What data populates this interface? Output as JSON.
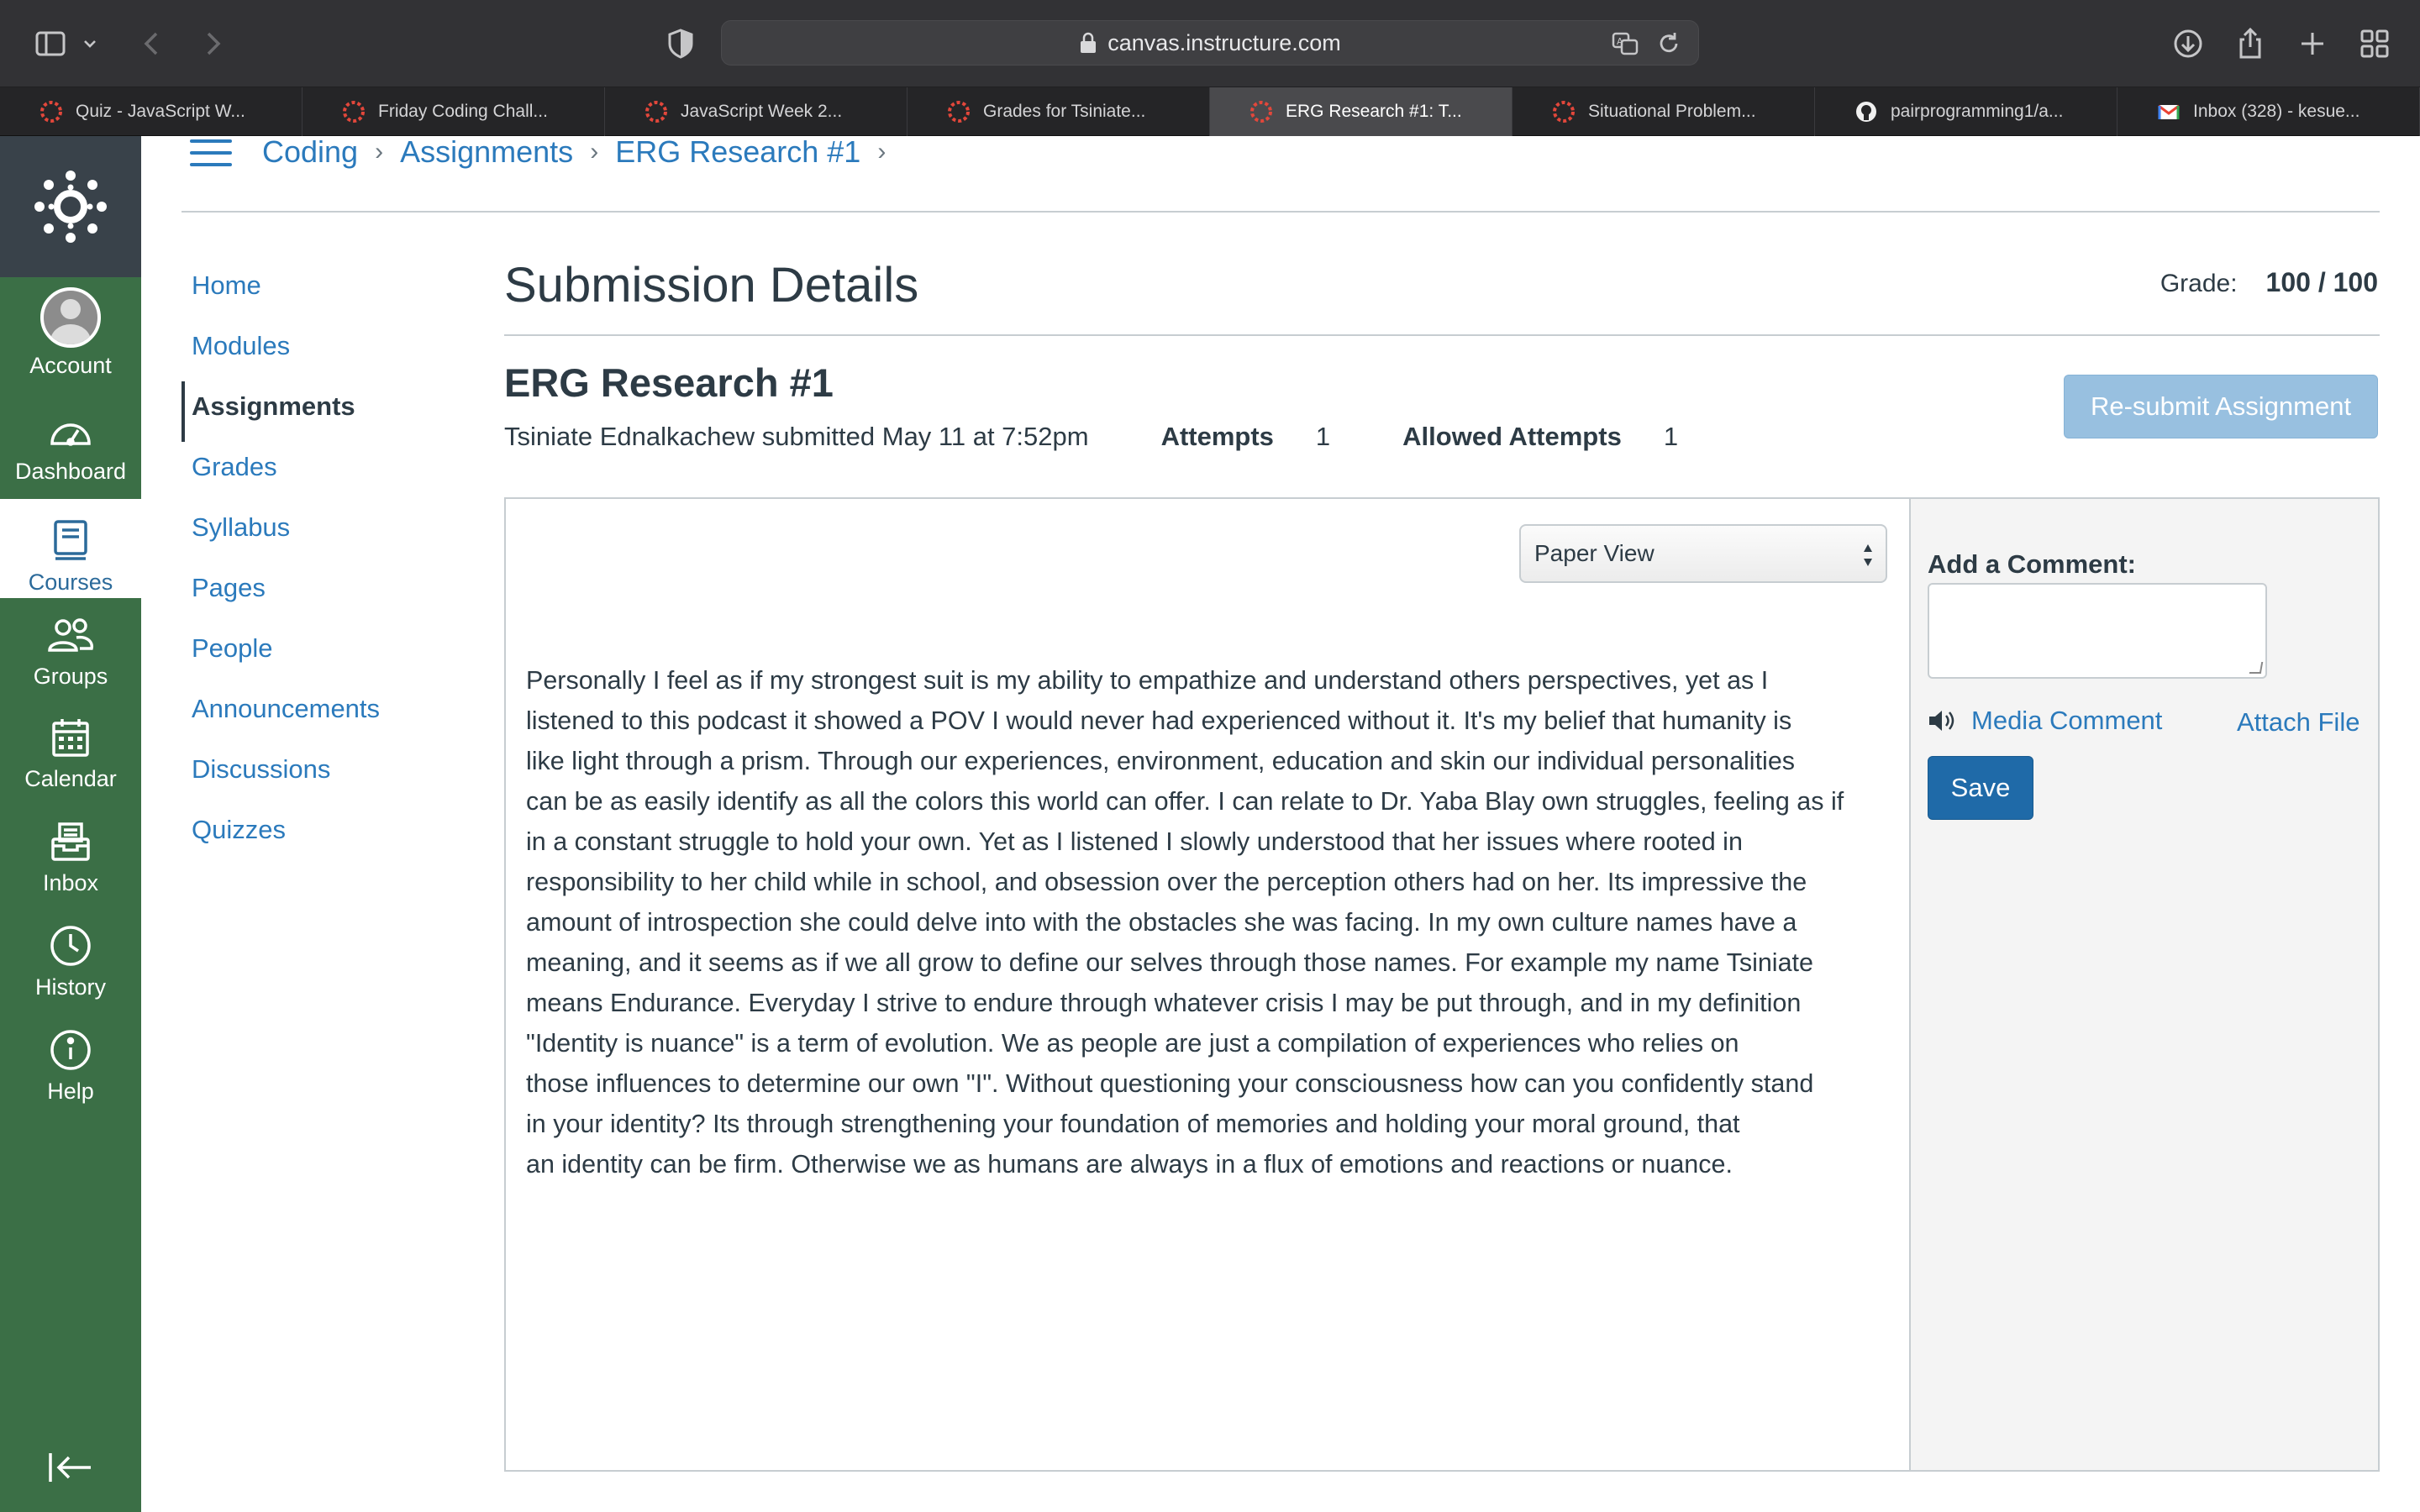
{
  "browser": {
    "url": "canvas.instructure.com",
    "tabs": [
      {
        "title": "Quiz - JavaScript W...",
        "favicon": "canvas-icon",
        "active": false
      },
      {
        "title": "Friday Coding Chall...",
        "favicon": "canvas-icon",
        "active": false
      },
      {
        "title": "JavaScript Week 2...",
        "favicon": "canvas-icon",
        "active": false
      },
      {
        "title": "Grades for Tsiniate...",
        "favicon": "canvas-icon",
        "active": false
      },
      {
        "title": "ERG Research #1: T...",
        "favicon": "canvas-icon",
        "active": true
      },
      {
        "title": "Situational Problem...",
        "favicon": "canvas-icon",
        "active": false
      },
      {
        "title": "pairprogramming1/a...",
        "favicon": "github-icon",
        "active": false
      },
      {
        "title": "Inbox (328) - kesue...",
        "favicon": "gmail-icon",
        "active": false
      }
    ]
  },
  "global_nav": {
    "items": [
      {
        "label": "Account",
        "icon": "avatar-icon"
      },
      {
        "label": "Dashboard",
        "icon": "dashboard-icon"
      },
      {
        "label": "Courses",
        "icon": "courses-icon"
      },
      {
        "label": "Groups",
        "icon": "groups-icon"
      },
      {
        "label": "Calendar",
        "icon": "calendar-icon"
      },
      {
        "label": "Inbox",
        "icon": "inbox-icon"
      },
      {
        "label": "History",
        "icon": "history-icon"
      },
      {
        "label": "Help",
        "icon": "help-icon"
      }
    ],
    "active": "Courses",
    "colors": {
      "nav_bg": "#3b6f46",
      "logo_bg": "#39424a",
      "link": "#2b7abc",
      "text": "#2d3b45"
    }
  },
  "breadcrumb": [
    "Coding",
    "Assignments",
    "ERG Research #1"
  ],
  "course_nav": {
    "items": [
      "Home",
      "Modules",
      "Assignments",
      "Grades",
      "Syllabus",
      "Pages",
      "People",
      "Announcements",
      "Discussions",
      "Quizzes"
    ],
    "active": "Assignments"
  },
  "main": {
    "page_title": "Submission Details",
    "grade_label": "Grade:",
    "grade_value": "100 / 100",
    "assignment_title": "ERG Research #1",
    "submitted_text": "Tsiniate Ednalkachew submitted May 11 at 7:52pm",
    "attempts_label": "Attempts",
    "attempts_value": "1",
    "allowed_attempts_label": "Allowed Attempts",
    "allowed_attempts_value": "1",
    "resubmit_label": "Re-submit Assignment",
    "view_select_value": "Paper View",
    "submission_text": "Personally I feel as if my strongest suit is my ability to empathize and understand others perspectives, yet as I\nlistened to this podcast it showed a POV I would never had experienced without it. It's my belief that humanity is\nlike light through a prism. Through our experiences, environment, education and skin our individual personalities\ncan be as easily identify as all the colors this world can offer. I can relate to Dr. Yaba Blay own struggles, feeling as if\nin a constant struggle to hold your own. Yet as I listened I slowly understood that her issues where rooted in\nresponsibility to her child while in school, and obsession over the perception others had on her. Its impressive the\namount of introspection she could delve into with the obstacles she was facing. In my own culture names have a\nmeaning, and it seems as if we all grow to define our selves through those names. For example my name Tsiniate\nmeans Endurance. Everyday I strive to endure through whatever crisis I may be put through, and in my definition\n\"Identity is nuance\" is a term of evolution. We as people are just a compilation of experiences who relies on\nthose influences to determine our own \"I\". Without questioning your consciousness how can you confidently stand\nin your identity? Its through strengthening your foundation of memories and holding your moral ground, that\nan identity can be firm. Otherwise we as humans are always in a flux of emotions and reactions or nuance."
  },
  "comments": {
    "label": "Add a Comment:",
    "media_comment": "Media Comment",
    "attach_file": "Attach File",
    "save": "Save"
  }
}
